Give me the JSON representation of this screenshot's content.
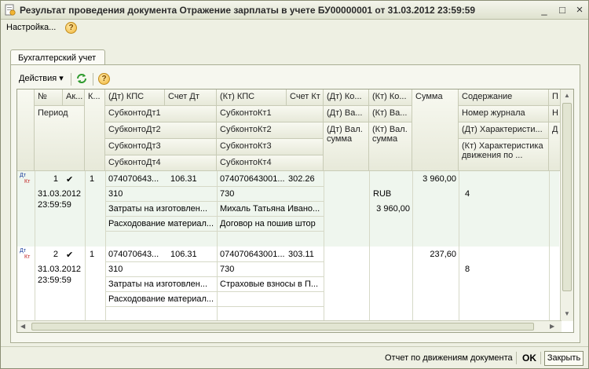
{
  "window": {
    "title": "Результат проведения документа Отражение зарплаты в учете БУ00000001 от 31.03.2012 23:59:59",
    "minimize_glyph": "_",
    "maximize_glyph": "□",
    "close_glyph": "×"
  },
  "menu": {
    "settings_label": "Настройка...",
    "help_glyph": "?"
  },
  "tabs": [
    {
      "label": "Бухгалтерский учет"
    }
  ],
  "toolbar": {
    "actions_label": "Действия",
    "dropdown_glyph": "▾",
    "help_glyph": "?"
  },
  "table": {
    "headers": {
      "num": "№",
      "active": "Ак...",
      "k": "К...",
      "dt_kps": "(Дт) КПС",
      "schet_dt": "Счет Дт",
      "kt_kps": "(Кт) КПС",
      "schet_kt": "Счет Кт",
      "dt_ko": "(Дт) Ко...",
      "kt_ko": "(Кт) Ко...",
      "summa": "Сумма",
      "soderzhanie": "Содержание",
      "p": "П",
      "period": "Период",
      "subkonto_dt1": "СубконтоДт1",
      "subkonto_dt2": "СубконтоДт2",
      "subkonto_dt3": "СубконтоДт3",
      "subkonto_dt4": "СубконтоДт4",
      "subkonto_kt1": "СубконтоКт1",
      "subkonto_kt2": "СубконтоКт2",
      "subkonto_kt3": "СубконтоКт3",
      "subkonto_kt4": "СубконтоКт4",
      "dt_va": "(Дт) Ва...",
      "kt_va": "(Кт) Ва...",
      "dt_val_summa": "(Дт) Вал. сумма",
      "kt_val_summa": "(Кт) Вал. сумма",
      "nomer_zhurnala": "Номер журнала",
      "dt_harakteristika": "(Дт) Характеристи...",
      "kt_harakteristika": "(Кт) Характеристика движения по ...",
      "h": "Н",
      "d": "Д"
    },
    "rows": [
      {
        "dt_label": "Дт",
        "kt_label": "Кт",
        "num": "1",
        "active_mark": "✔",
        "k": "1",
        "period": "31.03.2012 23:59:59",
        "dt_kps": "074070643...",
        "schet_dt": "106.31",
        "kt_kps": "074070643001...",
        "schet_kt": "302.26",
        "summa": "3 960,00",
        "dt_line2": "310",
        "kt_line2": "730",
        "kt_va": "RUB",
        "soderzhanie_line2": "4",
        "subkonto_dt2": "Затраты на изготовлен...",
        "subkonto_kt2": "Михаль Татьяна Ивано...",
        "kt_val_summa": "3 960,00",
        "subkonto_dt3": "Расходование материал...",
        "subkonto_kt3": "Договор на пошив штор"
      },
      {
        "dt_label": "Дт",
        "kt_label": "Кт",
        "num": "2",
        "active_mark": "✔",
        "k": "1",
        "period": "31.03.2012 23:59:59",
        "dt_kps": "074070643...",
        "schet_dt": "106.31",
        "kt_kps": "074070643001...",
        "schet_kt": "303.11",
        "summa": "237,60",
        "dt_line2": "310",
        "kt_line2": "730",
        "soderzhanie_line2": "8",
        "subkonto_dt2": "Затраты на изготовлен...",
        "subkonto_kt2": "Страховые взносы в П...",
        "subkonto_dt3": "Расходование материал..."
      }
    ]
  },
  "footer": {
    "report_label": "Отчет по движениям документа",
    "ok_label": "OK",
    "close_label": "Закрыть"
  }
}
